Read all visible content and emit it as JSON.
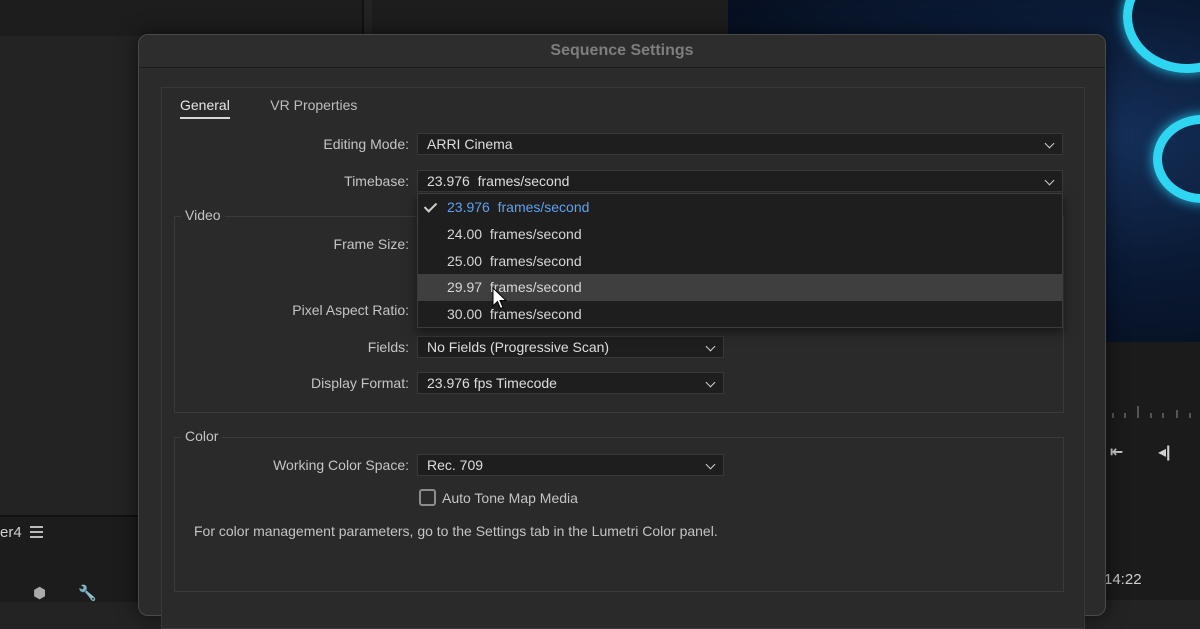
{
  "dialog": {
    "title": "Sequence Settings"
  },
  "tabs": [
    {
      "label": "General",
      "active": true
    },
    {
      "label": "VR Properties",
      "active": false
    }
  ],
  "editing_mode": {
    "label": "Editing Mode:",
    "value": "ARRI Cinema"
  },
  "timebase": {
    "label": "Timebase:",
    "value": "23.976  frames/second",
    "options": [
      {
        "label": "23.976  frames/second",
        "selected": true
      },
      {
        "label": "24.00  frames/second",
        "selected": false
      },
      {
        "label": "25.00  frames/second",
        "selected": false
      },
      {
        "label": "29.97  frames/second",
        "hovered": true
      },
      {
        "label": "30.00  frames/second",
        "selected": false
      }
    ]
  },
  "video": {
    "title": "Video",
    "frame_size_label": "Frame Size:",
    "pixel_aspect_label": "Pixel Aspect Ratio:",
    "fields": {
      "label": "Fields:",
      "value": "No Fields (Progressive Scan)"
    },
    "display_format": {
      "label": "Display Format:",
      "value": "23.976 fps Timecode"
    }
  },
  "color": {
    "title": "Color",
    "working_space": {
      "label": "Working Color Space:",
      "value": "Rec. 709"
    },
    "tone_map": {
      "label": "Auto Tone Map Media",
      "checked": false
    },
    "note": "For color management parameters, go to the Settings tab in the Lumetri Color panel."
  },
  "background": {
    "panel_label": "er4",
    "timecode": "14:22"
  },
  "colors": {
    "accent": "#5ea1f2",
    "hover": "#3f3f3f"
  }
}
